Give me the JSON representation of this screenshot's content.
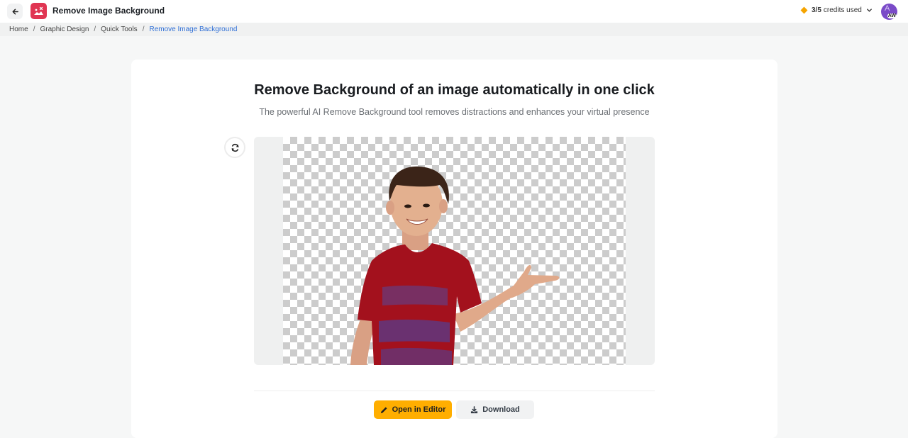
{
  "header": {
    "back_icon": "arrow-left-icon",
    "app_icon": "remove-background-icon",
    "app_color": "#e03552",
    "title": "Remove Image Background",
    "credits": {
      "icon": "diamond-icon",
      "count": "3/5",
      "label": "credits used",
      "dropdown_icon": "chevron-down-icon"
    },
    "avatar": {
      "letter": "A",
      "initials": "AW",
      "color": "#7a4bc8"
    }
  },
  "breadcrumb": {
    "items": [
      "Home",
      "Graphic Design",
      "Quick Tools"
    ],
    "current": "Remove Image Background",
    "separator": "/"
  },
  "main": {
    "headline": "Remove Background of an image automatically in one click",
    "subheadline": "The powerful AI Remove Background tool removes distractions and enhances your virtual presence",
    "refresh_icon": "refresh-icon",
    "preview": {
      "description": "Smiling boy in red t-shirt pointing right, background removed (transparent checkerboard)"
    },
    "actions": {
      "open_editor": "Open in Editor",
      "download": "Download",
      "accent_color": "#ffae00"
    }
  }
}
